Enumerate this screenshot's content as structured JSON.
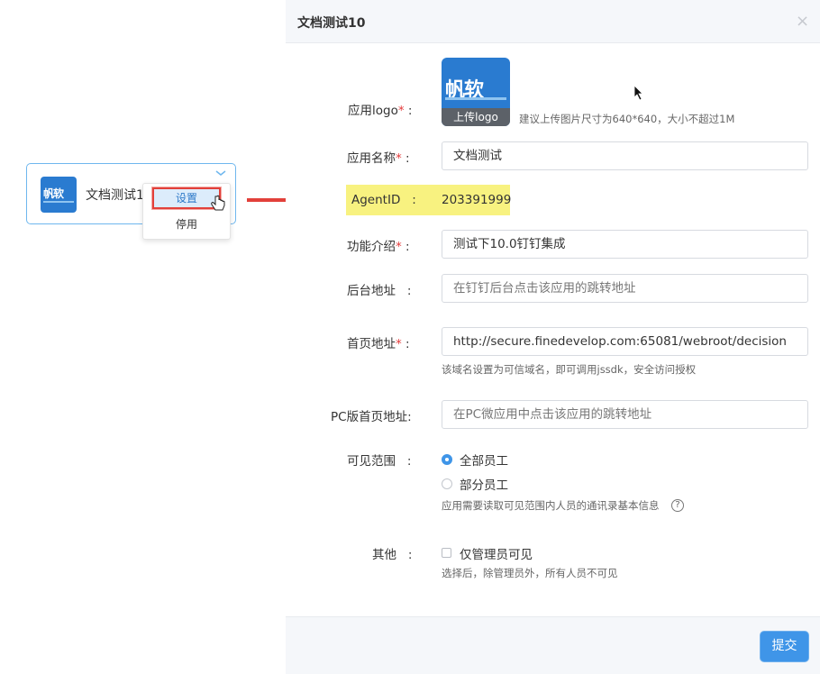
{
  "card": {
    "logo_text": "帆软",
    "name": "文档测试1",
    "menu_settings": "设置",
    "menu_disable": "停用"
  },
  "dialog": {
    "title": "文档测试10",
    "close": "×",
    "submit": "提交"
  },
  "form": {
    "logo_label": "应用logo",
    "logo_brand": "帆软",
    "logo_upload": "上传logo",
    "logo_hint": "建议上传图片尺寸为640*640，大小不超过1M",
    "name_label": "应用名称",
    "name_value": "文档测试",
    "agent_label": "AgentID",
    "agent_value": "203391999",
    "intro_label": "功能介绍",
    "intro_value": "测试下10.0钉钉集成",
    "backend_label": "后台地址",
    "backend_placeholder": "在钉钉后台点击该应用的跳转地址",
    "home_label": "首页地址",
    "home_value": "http://secure.finedevelop.com:65081/webroot/decision",
    "home_hint": "该域名设置为可信域名，即可调用jssdk，安全访问授权",
    "pc_label": "PC版首页地址:",
    "pc_placeholder": "在PC微应用中点击该应用的跳转地址",
    "scope_label": "可见范围",
    "scope_all": "全部员工",
    "scope_part": "部分员工",
    "scope_hint": "应用需要读取可见范围内人员的通讯录基本信息",
    "help": "?",
    "other_label": "其他",
    "admin_only": "仅管理员可见",
    "admin_hint": "选择后，除管理员外，所有人员不可见",
    "required_mark": "*",
    "colon": ":"
  },
  "colors": {
    "accent": "#3f95e8",
    "highlight": "#f8f280",
    "required": "#e33b3b",
    "arrow": "#e2403a"
  }
}
